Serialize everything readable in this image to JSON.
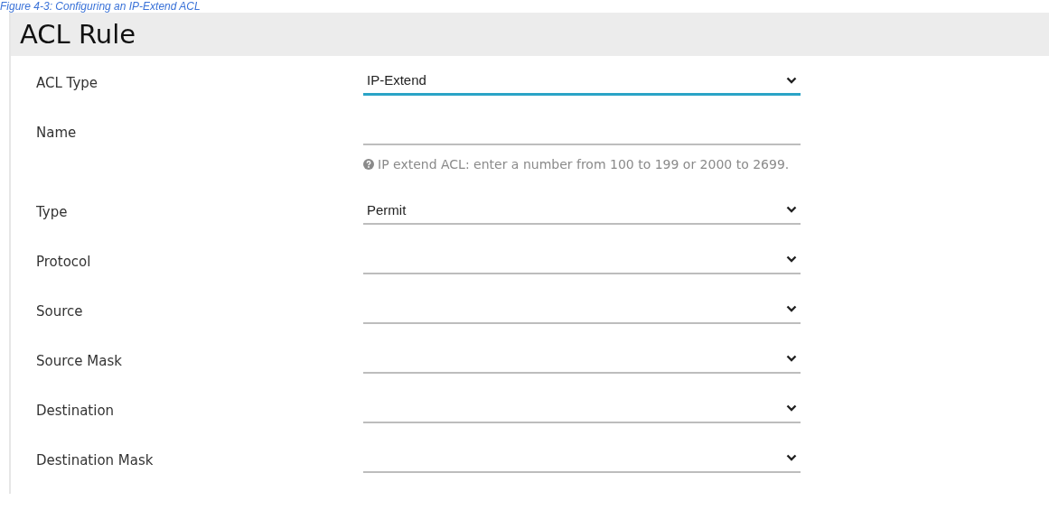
{
  "caption": "Figure 4-3: Configuring an IP-Extend ACL",
  "panel": {
    "title": "ACL Rule"
  },
  "fields": [
    {
      "kind": "select",
      "label": "ACL Type",
      "value": "IP-Extend",
      "focused": true
    },
    {
      "kind": "input",
      "label": "Name",
      "focused": false,
      "hint": "IP extend ACL: enter a number from 100 to 199 or 2000 to 2699."
    },
    {
      "kind": "select",
      "label": "Type",
      "value": "Permit",
      "focused": false
    },
    {
      "kind": "select",
      "label": "Protocol",
      "focused": false
    },
    {
      "kind": "select",
      "label": "Source",
      "focused": false
    },
    {
      "kind": "select",
      "label": "Source Mask",
      "focused": false
    },
    {
      "kind": "select",
      "label": "Destination",
      "focused": false
    },
    {
      "kind": "select",
      "label": "Destination Mask",
      "focused": false
    }
  ]
}
